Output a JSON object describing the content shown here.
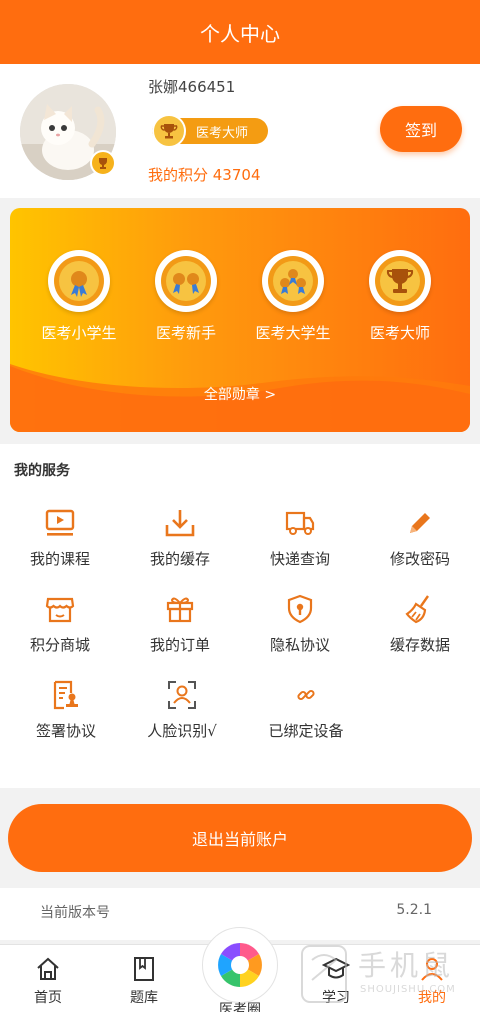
{
  "header": {
    "title": "个人中心"
  },
  "profile": {
    "username": "张娜466451",
    "level": "医考大师",
    "points": "我的积分 43704",
    "signin_label": "签到"
  },
  "badges": {
    "items": [
      {
        "label": "医考小学生",
        "icon": "medal-ribbon-icon"
      },
      {
        "label": "医考新手",
        "icon": "medal-double-ribbon-icon"
      },
      {
        "label": "医考大学生",
        "icon": "medal-triple-ribbon-icon"
      },
      {
        "label": "医考大师",
        "icon": "trophy-icon"
      }
    ],
    "all_label": "全部勋章 >"
  },
  "services": {
    "title": "我的服务",
    "items": [
      {
        "label": "我的课程",
        "icon": "video-play-icon"
      },
      {
        "label": "我的缓存",
        "icon": "download-icon"
      },
      {
        "label": "快递查询",
        "icon": "truck-icon"
      },
      {
        "label": "修改密码",
        "icon": "pencil-icon"
      },
      {
        "label": "积分商城",
        "icon": "store-icon"
      },
      {
        "label": "我的订单",
        "icon": "gift-icon"
      },
      {
        "label": "隐私协议",
        "icon": "shield-lock-icon"
      },
      {
        "label": "缓存数据",
        "icon": "broom-icon"
      },
      {
        "label": "签署协议",
        "icon": "contract-stamp-icon"
      },
      {
        "label": "人脸识别√",
        "icon": "face-scan-icon"
      },
      {
        "label": "已绑定设备",
        "icon": "link-icon"
      }
    ]
  },
  "logout_label": "退出当前账户",
  "version": {
    "label": "当前版本号",
    "value": "5.2.1"
  },
  "tabbar": {
    "items": [
      {
        "label": "首页",
        "icon": "home-icon"
      },
      {
        "label": "题库",
        "icon": "book-icon"
      },
      {
        "label": "医考圈",
        "icon": "aperture-icon"
      },
      {
        "label": "学习",
        "icon": "graduation-cap-icon"
      },
      {
        "label": "我的",
        "icon": "user-icon"
      }
    ],
    "active": "我的"
  },
  "watermark": {
    "text": "手机鼠",
    "subtext": "SHOUJISHU.COM"
  },
  "colors": {
    "accent": "#ff6d0f",
    "gold": "#f6b21c",
    "background": "#f2f2f2"
  }
}
